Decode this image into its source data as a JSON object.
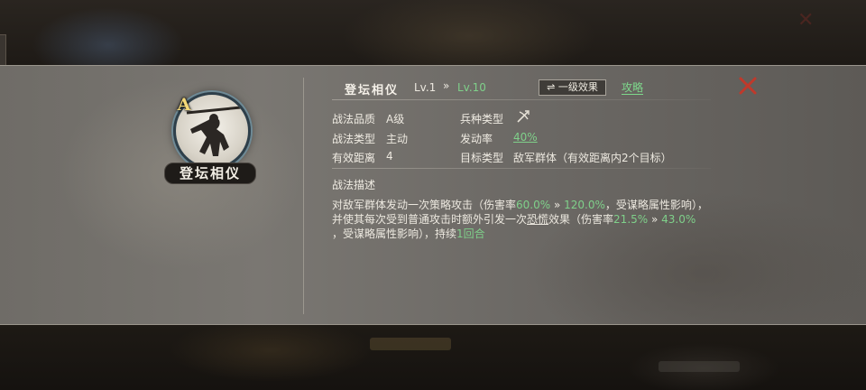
{
  "background": {
    "close_glyph": "✕"
  },
  "portrait": {
    "grade": "A",
    "name": "登坛相仪"
  },
  "header": {
    "skill_name": "登坛相仪",
    "level_from": "Lv.1",
    "arrow": "»",
    "level_to": "Lv.10",
    "effect_button": "⇌ 一级效果",
    "guide_link": "攻略"
  },
  "attributes": {
    "quality_label": "战法品质",
    "quality_value": "A级",
    "troop_label": "兵种类型",
    "troop_icon": "crossbow-icon",
    "type_label": "战法类型",
    "type_value": "主动",
    "rate_label": "发动率",
    "rate_value": "40%",
    "range_label": "有效距离",
    "range_value": "4",
    "target_label": "目标类型",
    "target_value": "敌军群体（有效距离内2个目标）"
  },
  "description": {
    "title": "战法描述",
    "p1": "对敌军群体发动一次策略攻击（伤害率",
    "dmg_from": "60.0%",
    "arrow1": " » ",
    "dmg_to": "120.0%",
    "p2": "，受谋略属性影响），",
    "p3": "并使其每次受到普通攻击时额外引发一次",
    "status_word": "恐慌",
    "p4": "效果（伤害率",
    "fear_from": "21.5%",
    "arrow2": " » ",
    "fear_to": "43.0%",
    "p5": "，受谋略属性影响），持续",
    "duration": "1回合"
  },
  "colors": {
    "highlight_green": "#7fd08a",
    "close_red": "#c0392b",
    "grade_gold": "#f3d878"
  }
}
